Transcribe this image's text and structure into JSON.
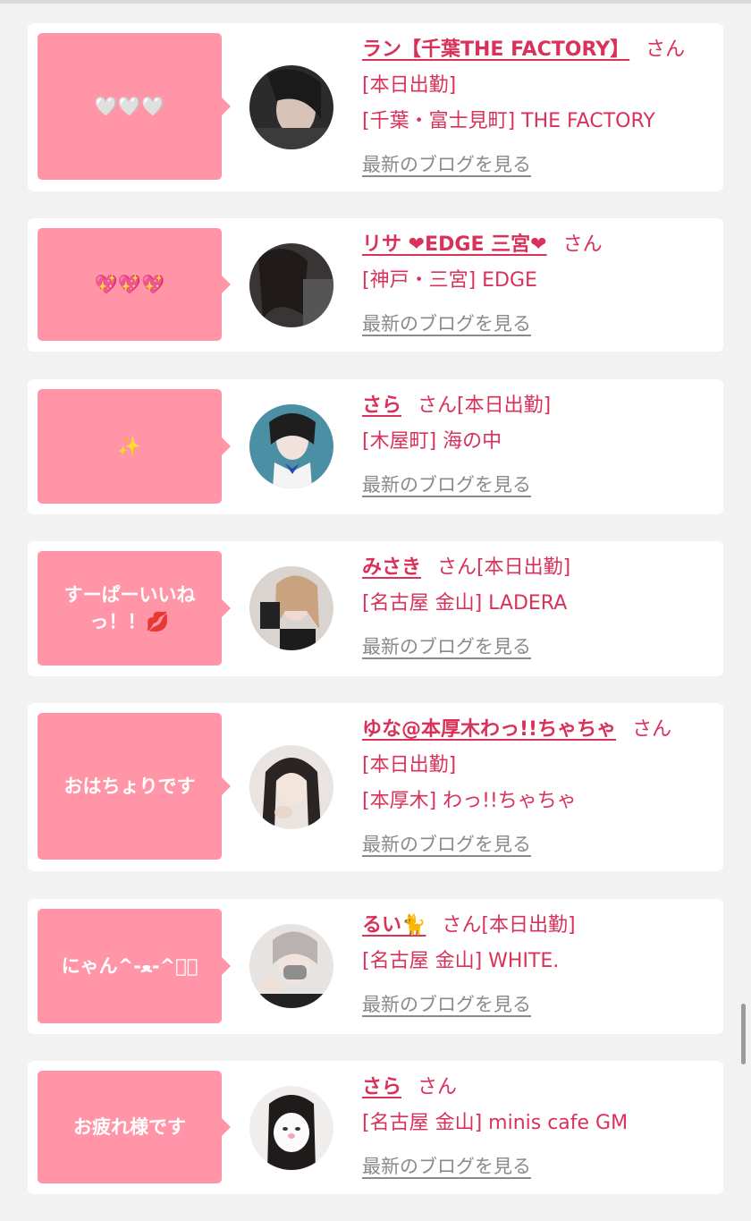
{
  "colors": {
    "accent": "#d9315a",
    "bubble": "#ff95a6",
    "link_gray": "#8a8a8a"
  },
  "entries": [
    {
      "message": "🤍🤍🤍",
      "name": "ラン【千葉THE FACTORY】",
      "san": "さん",
      "status": "[本日出勤]",
      "location": "[千葉・富士見町] THE FACTORY",
      "blog_link": "最新のブログを見る"
    },
    {
      "message": "💖💖💖",
      "name": "リサ ❤EDGE 三宮❤",
      "san": "さん",
      "location": "[神戸・三宮] EDGE",
      "blog_link": "最新のブログを見る"
    },
    {
      "message": "✨",
      "name": "さら",
      "san": "さん",
      "status": "[本日出勤]",
      "location": "[木屋町] 海の中",
      "blog_link": "最新のブログを見る"
    },
    {
      "message": "すーぱーいいねっ！！💋",
      "name": "みさき",
      "san": "さん",
      "status": "[本日出勤]",
      "location": "[名古屋 金山] LADERA",
      "blog_link": "最新のブログを見る"
    },
    {
      "message": "おはちょりです",
      "name": "ゆな@本厚木わっ!!ちゃちゃ",
      "san": "さん",
      "status": "[本日出勤]",
      "location": "[本厚木] わっ!!ちゃちゃ",
      "blog_link": "最新のブログを見る"
    },
    {
      "message": "にゃん^-ﻌ-^ฅ゙",
      "name": "るい🐈",
      "san": "さん",
      "status": "[本日出勤]",
      "location": "[名古屋 金山] WHITE.",
      "blog_link": "最新のブログを見る"
    },
    {
      "message": "お疲れ様です",
      "name": "さら",
      "san": "さん",
      "location": "[名古屋 金山] minis cafe GM",
      "blog_link": "最新のブログを見る"
    }
  ]
}
